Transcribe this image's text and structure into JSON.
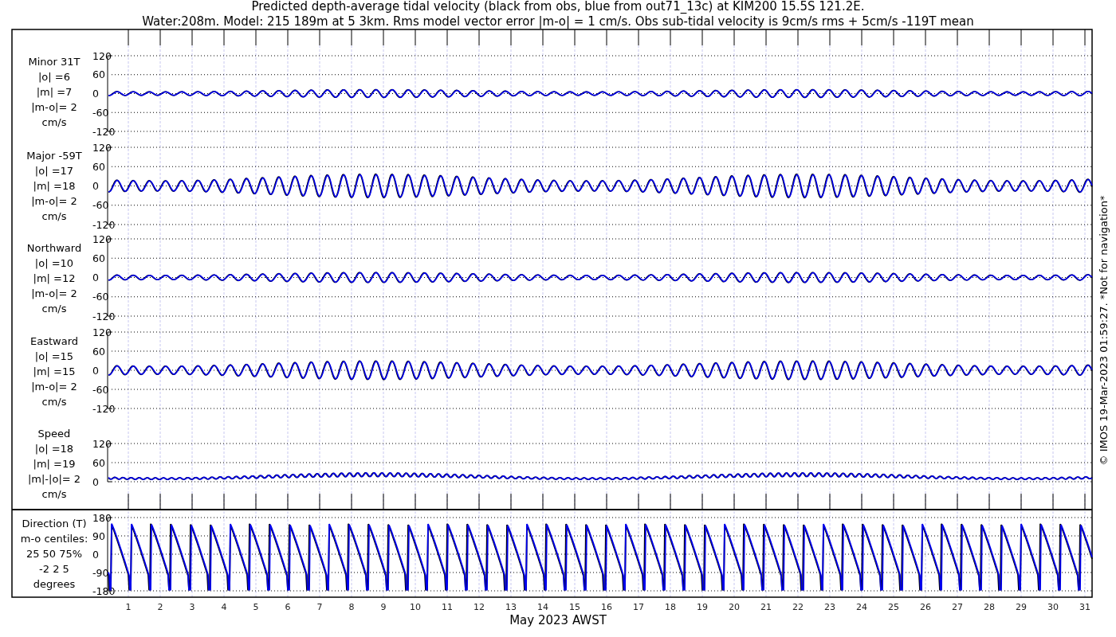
{
  "title_lines": [
    "Predicted depth-average tidal velocity (black from obs, blue from out71_13c) at KIM200 15.5S 121.2E.",
    "Water:208m. Model: 215 189m at 5 3km. Rms model vector error |m-o| = 1 cm/s. Obs sub-tidal velocity is 9cm/s rms + 5cm/s -119T mean"
  ],
  "panels": [
    {
      "kind": "velocity",
      "label_lines": [
        "Minor 31T",
        "|o| =6",
        "|m| =7",
        "|m-o|= 2",
        "cm/s"
      ],
      "ticks": [
        "120",
        "60",
        "0",
        "-60",
        "-120"
      ]
    },
    {
      "kind": "velocity",
      "label_lines": [
        "Major -59T",
        "|o| =17",
        "|m| =18",
        "|m-o|= 2",
        "cm/s"
      ],
      "ticks": [
        "120",
        "60",
        "0",
        "-60",
        "-120"
      ]
    },
    {
      "kind": "velocity",
      "label_lines": [
        "Northward",
        "|o| =10",
        "|m| =12",
        "|m-o|= 2",
        "cm/s"
      ],
      "ticks": [
        "120",
        "60",
        "0",
        "-60",
        "-120"
      ]
    },
    {
      "kind": "velocity",
      "label_lines": [
        "Eastward",
        "|o| =15",
        "|m| =15",
        "|m-o|= 2",
        "cm/s"
      ],
      "ticks": [
        "120",
        "60",
        "0",
        "-60",
        "-120"
      ]
    },
    {
      "kind": "speed",
      "label_lines": [
        "Speed",
        "|o| =18",
        "|m| =19",
        "|m|-|o|= 2",
        "cm/s"
      ],
      "ticks": [
        "120",
        "60",
        "0"
      ]
    },
    {
      "kind": "direction",
      "label_lines": [
        "Direction (T)",
        "m-o centiles:",
        "25  50  75%",
        "-2  2  5",
        "degrees"
      ],
      "ticks": [
        "180",
        "90",
        "0",
        "-90",
        "-180"
      ]
    }
  ],
  "x_ticks": [
    "1",
    "2",
    "3",
    "4",
    "5",
    "6",
    "7",
    "8",
    "9",
    "10",
    "11",
    "12",
    "13",
    "14",
    "15",
    "16",
    "17",
    "18",
    "19",
    "20",
    "21",
    "22",
    "23",
    "24",
    "25",
    "26",
    "27",
    "28",
    "29",
    "30",
    "31"
  ],
  "xlabel": "May 2023 AWST",
  "credit": "© IMOS 19-Mar-2023 01:59:27. *Not for navigation*"
}
